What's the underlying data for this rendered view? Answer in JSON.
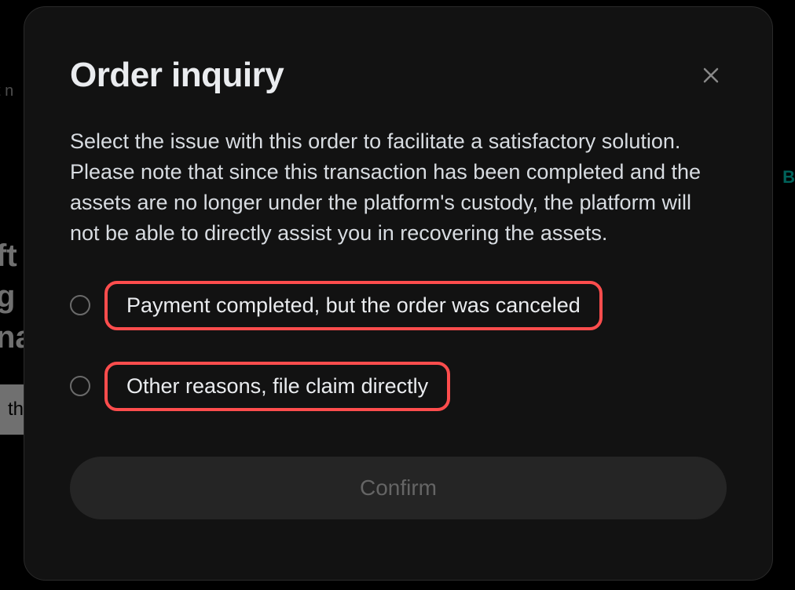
{
  "background": {
    "text_1": "t n",
    "text_b": "B",
    "text_left_line1": "ft",
    "text_left_line2": "g c",
    "text_left_line3": "na",
    "button_left": "th"
  },
  "modal": {
    "title": "Order inquiry",
    "description": "Select the issue with this order to facilitate a satisfactory solution. Please note that since this transaction has been completed and the assets are no longer under the platform's custody, the platform will not be able to directly assist you in recovering the assets.",
    "options": [
      {
        "label": "Payment completed, but the order was canceled"
      },
      {
        "label": "Other reasons, file claim directly"
      }
    ],
    "confirm_label": "Confirm"
  }
}
